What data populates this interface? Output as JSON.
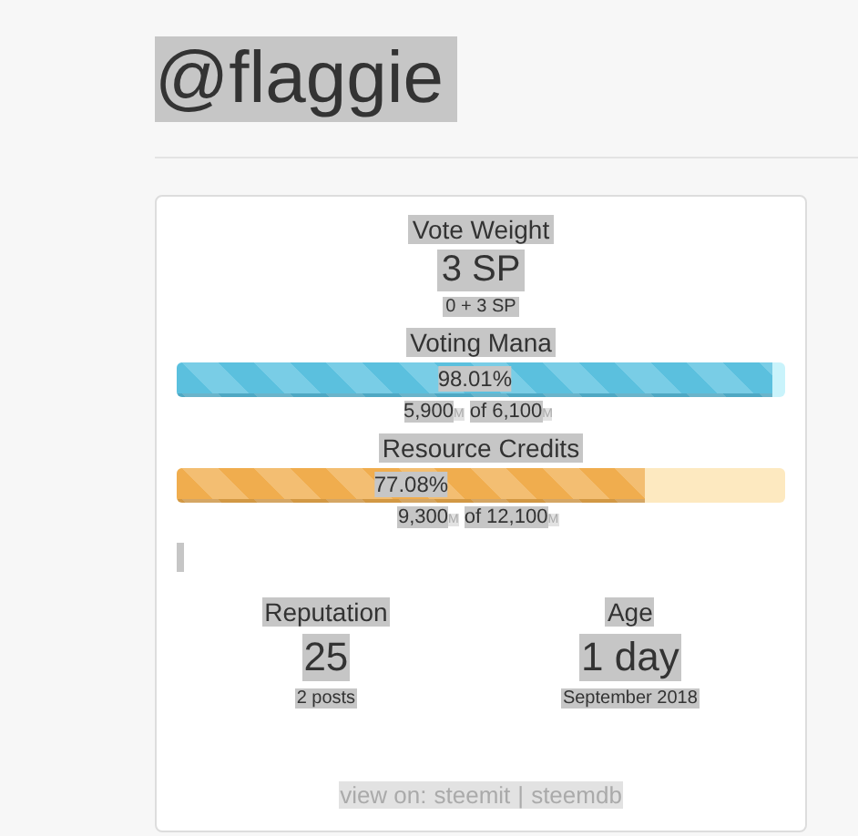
{
  "username": "@flaggie",
  "vote_weight": {
    "label": "Vote Weight",
    "value": "3 SP",
    "detail": "0 + 3 SP"
  },
  "meters": [
    {
      "label": "Voting Mana",
      "kind": "mana",
      "level": 0.9801,
      "percent": "98.01%",
      "current": "5,900",
      "current_unit": "M",
      "total": "of 6,100",
      "total_unit": "M"
    },
    {
      "label": "Resource Credits",
      "kind": "credits",
      "level": 0.7708,
      "percent": "77.08%",
      "current": "9,300",
      "current_unit": "M",
      "total": "of 12,100",
      "total_unit": "M"
    }
  ],
  "stats": [
    {
      "label": "Reputation",
      "value": "25",
      "detail": "2 posts"
    },
    {
      "label": "Age",
      "value": "1 day",
      "detail": "September 2018"
    }
  ],
  "footer": {
    "prefix": "view on:",
    "links": [
      "steemit",
      "steemdb"
    ],
    "separator": "|"
  }
}
